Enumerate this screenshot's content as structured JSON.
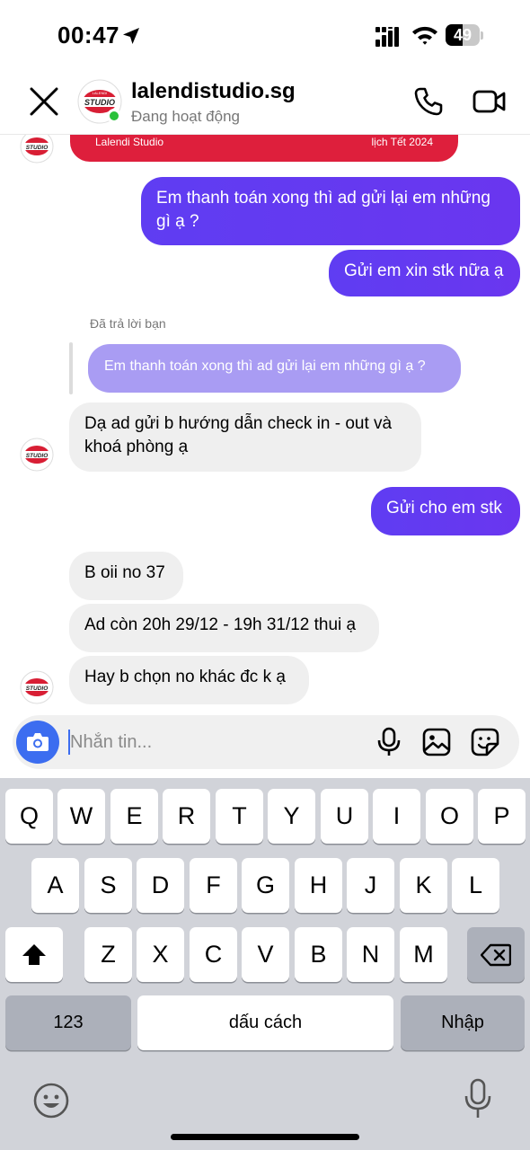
{
  "status_bar": {
    "time": "00:47",
    "battery": "49",
    "battery_level": 0.49
  },
  "header": {
    "contact_name": "lalendistudio.sg",
    "contact_status": "Đang hoạt động",
    "avatar_text": "STUDIO",
    "avatar_small_text": "LALENDI"
  },
  "shared_card": {
    "left_text": "Lalendi Studio",
    "right_text": "lịch Tết 2024"
  },
  "messages": [
    {
      "id": "m1",
      "side": "out",
      "lines": [
        "Em thanh toán xong thì ad gửi lại em những",
        "gì ạ ?"
      ]
    },
    {
      "id": "m2",
      "side": "out",
      "lines": [
        "Gửi em xin stk nữa ạ"
      ]
    },
    {
      "id": "m3",
      "side": "in",
      "lines": [
        "Dạ ad gửi b hướng dẫn check in - out và",
        "khoá phòng ạ"
      ]
    },
    {
      "id": "m4",
      "side": "out",
      "lines": [
        "Gửi cho em stk"
      ]
    },
    {
      "id": "m5",
      "side": "in",
      "lines": [
        "B oii no 37"
      ]
    },
    {
      "id": "m6",
      "side": "in",
      "lines": [
        "Ad còn 20h 29/12 - 19h 31/12 thui ạ"
      ]
    },
    {
      "id": "m7",
      "side": "in",
      "lines": [
        "Hay b chọn no khác đc k ạ"
      ]
    }
  ],
  "reply": {
    "label": "Đã trả lời bạn",
    "quoted": "Em thanh toán xong thì ad gửi lại em những gì ạ ?"
  },
  "composer": {
    "placeholder": "Nhắn tin..."
  },
  "keyboard": {
    "row1": [
      "Q",
      "W",
      "E",
      "R",
      "T",
      "Y",
      "U",
      "I",
      "O",
      "P"
    ],
    "row2": [
      "A",
      "S",
      "D",
      "F",
      "G",
      "H",
      "J",
      "K",
      "L"
    ],
    "row3": [
      "Z",
      "X",
      "C",
      "V",
      "B",
      "N",
      "M"
    ],
    "numbers_label": "123",
    "space_label": "dấu cách",
    "return_label": "Nhập"
  },
  "colors": {
    "outgoing_bubble": "#6239f1",
    "incoming_bubble": "#efefef",
    "quoted_bubble": "#a99cf3",
    "card_red": "#de1f3c",
    "online": "#29c13a",
    "camera_button": "#3c6df0"
  },
  "icons": [
    "location-arrow-icon",
    "signal-icon",
    "wifi-icon",
    "close-icon",
    "phone-icon",
    "video-icon",
    "camera-icon",
    "microphone-icon",
    "gallery-icon",
    "sticker-icon",
    "shift-icon",
    "backspace-icon",
    "emoji-icon",
    "dictation-icon"
  ]
}
